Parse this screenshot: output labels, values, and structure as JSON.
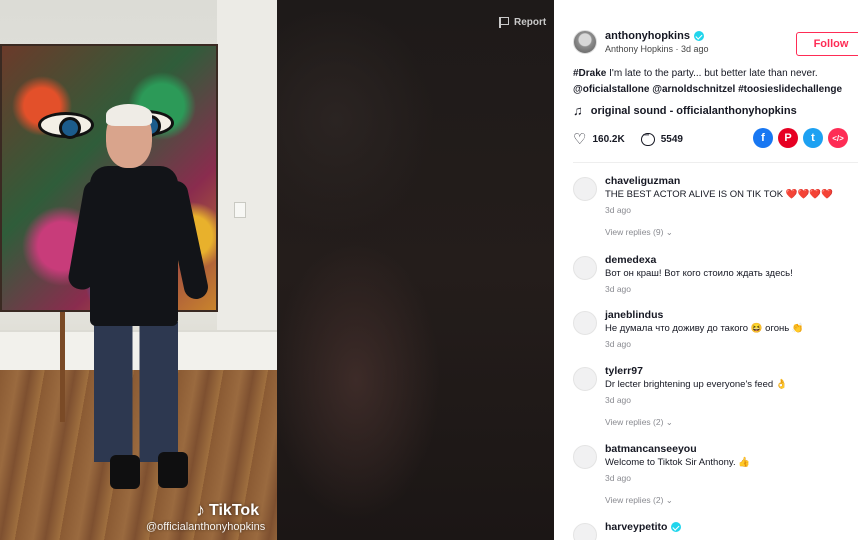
{
  "video": {
    "report_label": "Report",
    "tiktok_logo": "TikTok",
    "watermark": "@officialanthonyhopkins"
  },
  "author": {
    "username": "anthonyhopkins",
    "display_line": "Anthony Hopkins · 3d ago",
    "follow_label": "Follow"
  },
  "caption": {
    "hashtag": "#Drake",
    "text": " I'm late to the party... but better late than never.",
    "line2": "@oficialstallone @arnoldschnitzel #toosieslidechallenge"
  },
  "sound": {
    "icon": "music-note-icon",
    "label": "original sound - officialanthonyhopkins"
  },
  "stats": {
    "likes": "160.2K",
    "comments": "5549"
  },
  "share": [
    {
      "name": "facebook",
      "glyph": "f",
      "color": "#1877f2"
    },
    {
      "name": "pinterest",
      "glyph": "P",
      "color": "#e60023"
    },
    {
      "name": "twitter",
      "glyph": "t",
      "color": "#1da1f2"
    },
    {
      "name": "embed",
      "glyph": "</>",
      "color": "#fe2c55"
    }
  ],
  "comments": [
    {
      "user": "chaveliguzman",
      "text": "THE BEST ACTOR ALIVE IS ON TIK TOK ❤️❤️❤️❤️",
      "time": "3d ago",
      "replies": "View replies (9)"
    },
    {
      "user": "demedexa",
      "text": "Вот он краш! Вот кого стоило ждать здесь!",
      "time": "3d ago",
      "replies": ""
    },
    {
      "user": "janeblindus",
      "text": "Не думала что доживу до такого 😆 огонь 👏",
      "time": "3d ago",
      "replies": ""
    },
    {
      "user": "tylerr97",
      "text": "Dr lecter brightening up everyone's feed 👌",
      "time": "3d ago",
      "replies": "View replies (2)"
    },
    {
      "user": "batmancanseeyou",
      "text": "Welcome to Tiktok Sir Anthony. 👍",
      "time": "3d ago",
      "replies": "View replies (2)"
    },
    {
      "user": "harveypetito",
      "text": "",
      "time": "",
      "replies": "",
      "verified": true
    }
  ]
}
